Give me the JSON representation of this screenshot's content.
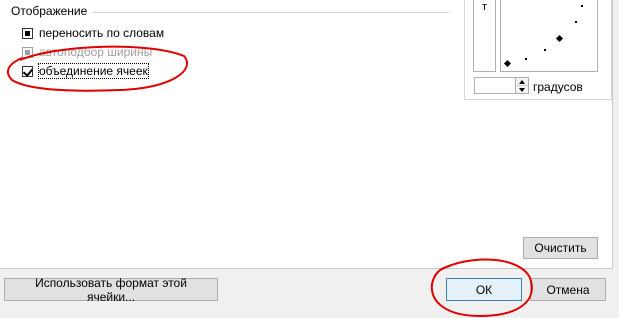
{
  "display_section": {
    "title": "Отображение",
    "options": [
      {
        "label": "переносить по словам",
        "state": "partial"
      },
      {
        "label": "автоподбор ширины",
        "state": "disabled"
      },
      {
        "label": "объединение ячеек",
        "state": "checked"
      }
    ]
  },
  "orientation": {
    "vertical_text": "т",
    "degrees_value": "",
    "degrees_label": "градусов"
  },
  "buttons": {
    "clear": "Очистить",
    "use_cell_format": "Использовать формат этой ячейки...",
    "ok": "ОК",
    "cancel": "Отмена"
  },
  "annotation_color": "#e00000"
}
